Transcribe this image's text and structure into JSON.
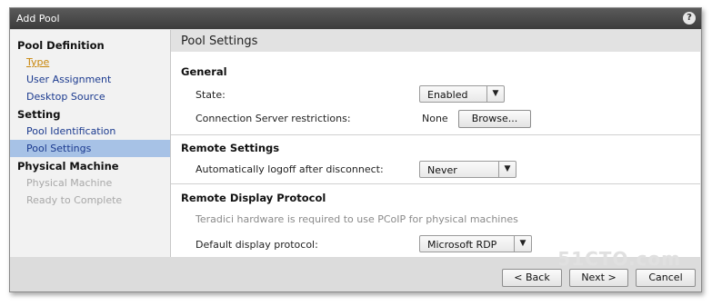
{
  "window": {
    "title": "Add Pool",
    "help_label": "?"
  },
  "sidebar": {
    "sections": [
      {
        "heading": "Pool Definition",
        "items": [
          "Type",
          "User Assignment",
          "Desktop Source"
        ]
      },
      {
        "heading": "Setting",
        "items": [
          "Pool Identification",
          "Pool Settings"
        ]
      },
      {
        "heading": "Physical Machine",
        "items": [
          "Physical Machine",
          "Ready to Complete"
        ]
      }
    ],
    "selected": "Pool Settings",
    "link_item": "Type"
  },
  "main": {
    "header": "Pool Settings",
    "general": {
      "heading": "General",
      "state_label": "State:",
      "state_value": "Enabled",
      "restrictions_label": "Connection Server restrictions:",
      "restrictions_value": "None",
      "browse_label": "Browse..."
    },
    "remote": {
      "heading": "Remote Settings",
      "logoff_label": "Automatically logoff after disconnect:",
      "logoff_value": "Never"
    },
    "display": {
      "heading": "Remote Display Protocol",
      "note": "Teradici hardware is required to use PCoIP for physical machines",
      "protocol_label": "Default display protocol:",
      "protocol_value": "Microsoft RDP"
    }
  },
  "footer": {
    "back_label": "< Back",
    "next_label": "Next >",
    "cancel_label": "Cancel"
  },
  "icons": {
    "dropdown": "chevron-down-icon",
    "help": "help-icon"
  },
  "colors": {
    "selected_nav": "#a7c2e6",
    "link": "#c8860a",
    "nav_text": "#1b3a8f",
    "titlebar": "#4a4a4a"
  },
  "watermark": "51CTO.com"
}
